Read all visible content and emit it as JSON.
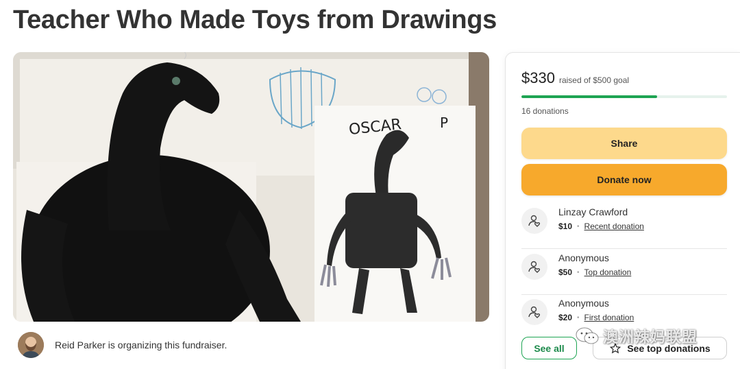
{
  "page": {
    "title": "Teacher Who Made Toys from Drawings"
  },
  "hero": {
    "drawing_label": "OSCAR",
    "drawing_letter": "P"
  },
  "organizer": {
    "text": "Reid Parker is organizing this fundraiser."
  },
  "donation_card": {
    "raised_amount": "$330",
    "raised_goal": "raised of $500 goal",
    "progress_fraction": 0.66,
    "donation_count": "16 donations",
    "share_label": "Share",
    "donate_label": "Donate now",
    "donors": [
      {
        "name": "Linzay Crawford",
        "amount": "$10",
        "tag": "Recent donation"
      },
      {
        "name": "Anonymous",
        "amount": "$50",
        "tag": "Top donation"
      },
      {
        "name": "Anonymous",
        "amount": "$20",
        "tag": "First donation"
      }
    ],
    "see_all_label": "See all",
    "see_top_label": "See top donations"
  },
  "watermark": {
    "text": "澳洲辣妈联盟"
  },
  "colors": {
    "accent_green": "#1ea453",
    "share_yellow": "#fdd98c",
    "donate_orange": "#f7a92c"
  },
  "icons": {
    "donor": "donor-heart-icon",
    "star": "star-icon",
    "watermark": "wechat-icon"
  }
}
